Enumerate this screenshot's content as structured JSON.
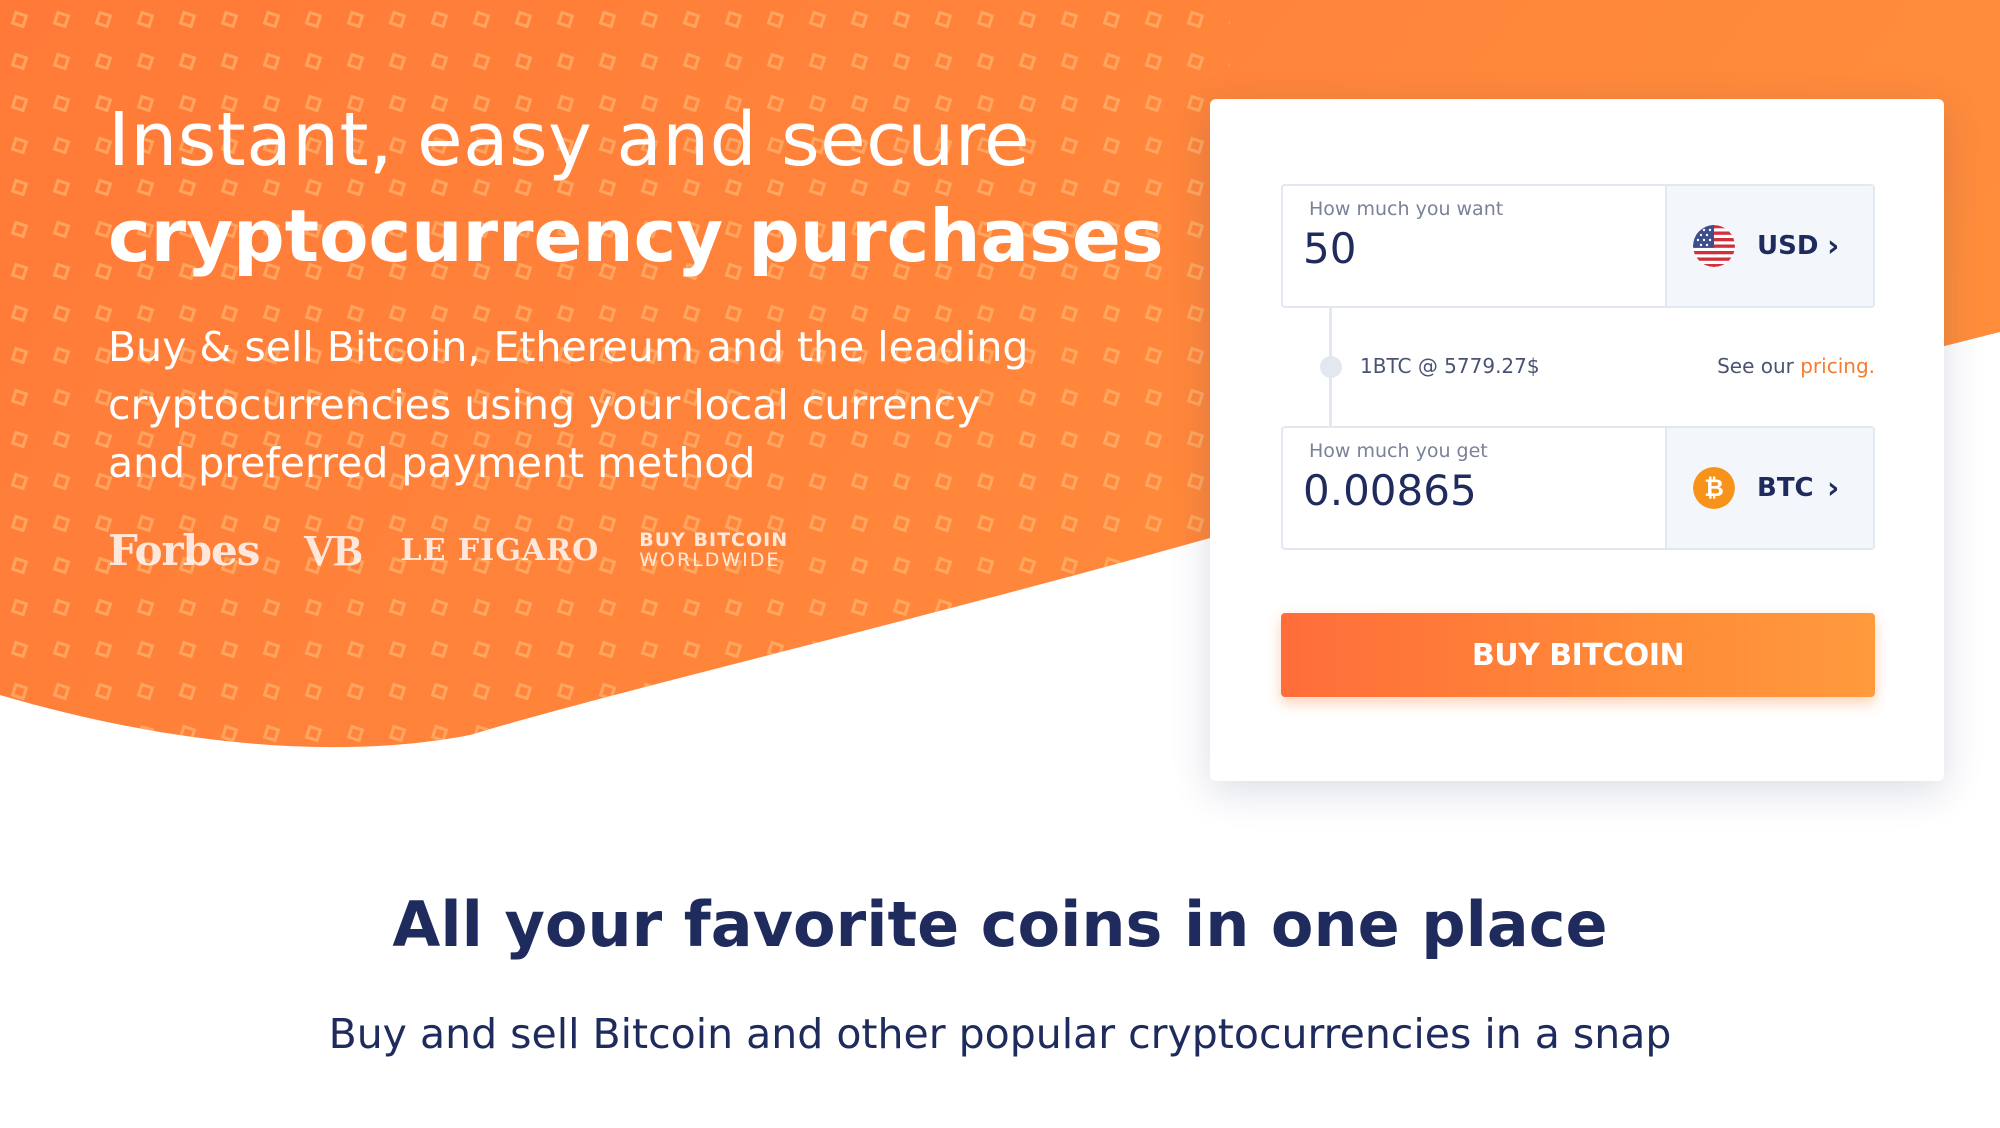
{
  "hero": {
    "title_line1": "Instant, easy and secure",
    "title_line2": "cryptocurrency purchases",
    "subtitle": "Buy & sell Bitcoin, Ethereum and the leading cryptocurrencies using your local currency and preferred payment method",
    "press_logos": {
      "forbes": "Forbes",
      "vb": "VB",
      "figaro": "LE FIGARO",
      "bbw_line1": "BUY BITCOIN",
      "bbw_line2": "WORLDWIDE"
    }
  },
  "widget": {
    "want": {
      "label": "How much you want",
      "value": "50",
      "currency": "USD",
      "icon": "us-flag-icon"
    },
    "rate": {
      "text": "1BTC @ 5779.27$",
      "pricing_prefix": "See our ",
      "pricing_link": "pricing."
    },
    "get": {
      "label": "How much you get",
      "value": "0.00865",
      "currency": "BTC",
      "icon": "bitcoin-icon"
    },
    "buy_label": "BUY BITCOIN"
  },
  "section": {
    "title": "All your favorite coins in one place",
    "subtitle": "Buy and sell Bitcoin and other popular cryptocurrencies in a snap"
  },
  "colors": {
    "brand_orange": "#f57b2f",
    "navy_text": "#1f2b5c",
    "field_border": "#e3e7ef",
    "bitcoin_orange": "#f7931a"
  }
}
